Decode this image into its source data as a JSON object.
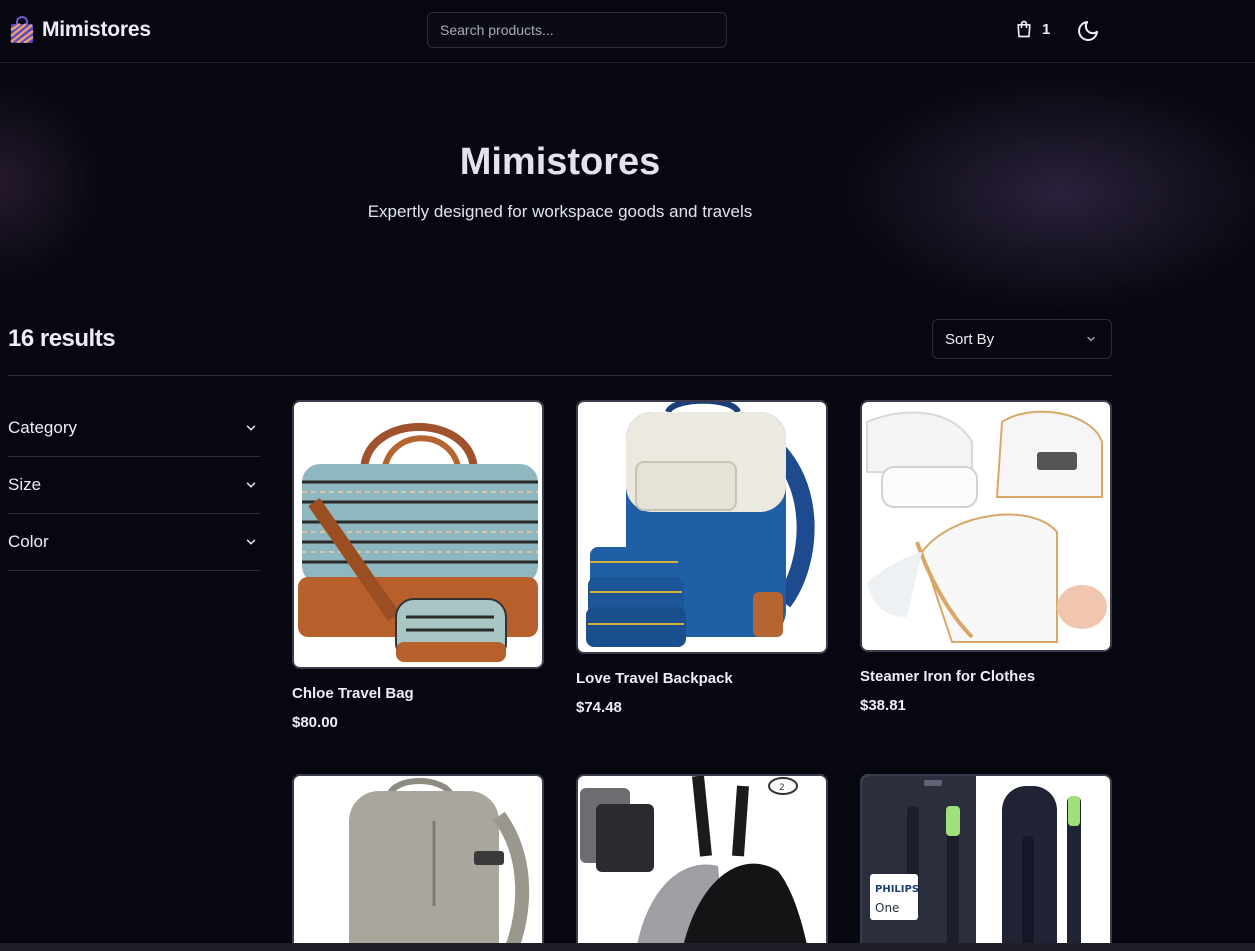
{
  "header": {
    "brand": "Mimistores",
    "search_placeholder": "Search products...",
    "cart_count": "1",
    "cart_icon": "shopping-bag-icon",
    "theme_icon": "moon-icon"
  },
  "hero": {
    "title": "Mimistores",
    "subtitle": "Expertly designed for workspace goods and travels"
  },
  "results": {
    "count_label": "16 results",
    "sort_label": "Sort By"
  },
  "filters": [
    {
      "label": "Category"
    },
    {
      "label": "Size"
    },
    {
      "label": "Color"
    }
  ],
  "products": [
    {
      "name": "Chloe Travel Bag",
      "price": "$80.00",
      "image": "travel-bag"
    },
    {
      "name": "Love Travel Backpack",
      "price": "$74.48",
      "image": "backpack"
    },
    {
      "name": "Steamer Iron for Clothes",
      "price": "$38.81",
      "image": "steamer-iron"
    },
    {
      "name": "",
      "price": "",
      "image": "grey-backpack"
    },
    {
      "name": "",
      "price": "",
      "image": "drawstring-bags",
      "badge": "2"
    },
    {
      "name": "",
      "price": "",
      "image": "toothbrush",
      "brand": "PHILIPS",
      "model": "One"
    }
  ],
  "colors": {
    "background": "#07080f",
    "text": "#ededf5",
    "border": "#2a2c3c"
  }
}
